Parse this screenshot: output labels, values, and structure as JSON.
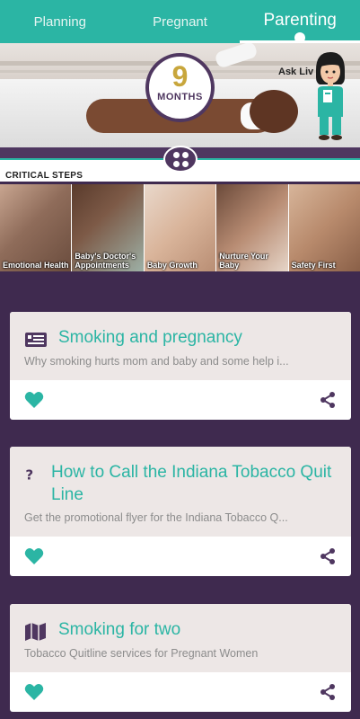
{
  "tabs": [
    {
      "label": "Planning",
      "active": false
    },
    {
      "label": "Pregnant",
      "active": false
    },
    {
      "label": "Parenting",
      "active": true
    }
  ],
  "hero": {
    "months_number": "9",
    "months_label": "MONTHS",
    "ask_liv": "Ask Liv"
  },
  "critical_steps": {
    "title": "CRITICAL STEPS",
    "items": [
      {
        "label": "Emotional Health"
      },
      {
        "label": "Baby's Doctor's Appointments"
      },
      {
        "label": "Baby Growth"
      },
      {
        "label": "Nurture Your Baby"
      },
      {
        "label": "Safety First"
      }
    ]
  },
  "cards": [
    {
      "icon": "newspaper-icon",
      "title": "Smoking and pregnancy",
      "desc": "Why smoking hurts mom and baby and some help i..."
    },
    {
      "icon": "question-icon",
      "title": "How to Call the Indiana Tobacco Quit Line",
      "desc": "Get the promotional flyer for the Indiana Tobacco Q..."
    },
    {
      "icon": "map-icon",
      "title": "Smoking for two",
      "desc": "Tobacco Quitline services for Pregnant Women"
    }
  ],
  "colors": {
    "teal": "#2bb5a4",
    "purple": "#4f3760",
    "feed_background": "#3f2a4f",
    "card_top": "#ede7e6"
  }
}
